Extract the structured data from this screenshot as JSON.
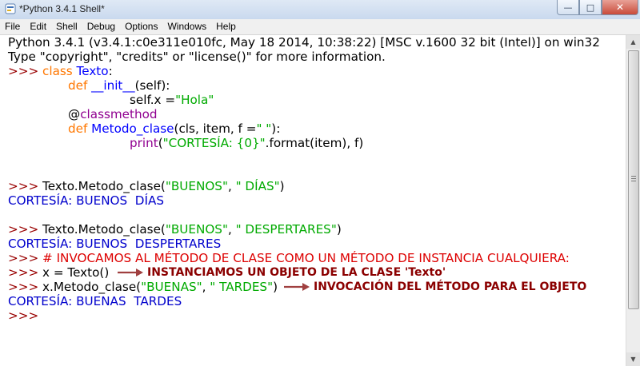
{
  "window": {
    "title": "*Python 3.4.1 Shell*",
    "controls": {
      "minimize": "—",
      "maximize": "□",
      "close": "✕"
    }
  },
  "menu": [
    "File",
    "Edit",
    "Shell",
    "Debug",
    "Options",
    "Windows",
    "Help"
  ],
  "shell": {
    "banner1": "Python 3.4.1 (v3.4.1:c0e311e010fc, May 18 2014, 10:38:22) [MSC v.1600 32 bit (Intel)] on win32",
    "banner2": "Type \"copyright\", \"credits\" or \"license()\" for more information.",
    "prompt": ">>> ",
    "code": {
      "kw_class": "class",
      "class_name": "Texto",
      "colon": ":",
      "kw_def": "def",
      "init_name": "__init__",
      "init_params": "(self):",
      "assign_lhs": "self.x =",
      "str_hola": "\"Hola\"",
      "decorator_at": "@",
      "decorator_name": "classmethod",
      "method_name": "Metodo_clase",
      "method_params": "(cls, item, f =",
      "str_space": "\" \"",
      "method_close": "):",
      "print_fn": "print",
      "paren_open": "(",
      "str_format": "\"CORTESÍA: {0}\"",
      "format_call": ".format(item), f)"
    },
    "call1": {
      "pre": "Texto.Metodo_clase(",
      "arg1": "\"BUENOS\"",
      "sep": ", ",
      "arg2": "\" DÍAS\"",
      "post": ")"
    },
    "out1": "CORTESÍA: BUENOS  DÍAS",
    "call2": {
      "pre": "Texto.Metodo_clase(",
      "arg1": "\"BUENOS\"",
      "sep": ", ",
      "arg2": "\" DESPERTARES\"",
      "post": ")"
    },
    "out2": "CORTESÍA: BUENOS  DESPERTARES",
    "comment_line": "# INVOCAMOS AL MÉTODO DE CLASE COMO UN MÉTODO DE INSTANCIA CUALQUIERA:",
    "inst_line": "x = Texto()",
    "call3": {
      "pre": "x.Metodo_clase(",
      "arg1": "\"BUENAS\"",
      "sep": ", ",
      "arg2": "\" TARDES\"",
      "post": ")"
    },
    "out3": "CORTESÍA: BUENAS  TARDES",
    "last_prompt": ">>>"
  },
  "annotations": {
    "instantiate": "INSTANCIAMOS UN OBJETO DE LA CLASE 'Texto'",
    "invoke": "INVOCACIÓN DEL MÉTODO PARA EL OBJETO",
    "color": "#8b0000"
  },
  "icons": {
    "app": "python-shell-icon",
    "arrow": "right-arrow-icon"
  }
}
